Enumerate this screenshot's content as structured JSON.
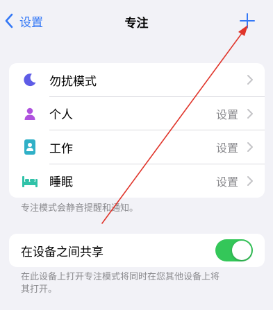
{
  "nav": {
    "back_label": "设置",
    "title": "专注"
  },
  "focus_modes": [
    {
      "label": "勿扰模式",
      "value": "",
      "icon": "moon-icon",
      "color": "#5e5ce6"
    },
    {
      "label": "个人",
      "value": "设置",
      "icon": "person-icon",
      "color": "#af52de"
    },
    {
      "label": "工作",
      "value": "设置",
      "icon": "badge-icon",
      "color": "#30b0c7"
    },
    {
      "label": "睡眠",
      "value": "设置",
      "icon": "bed-icon",
      "color": "#30c2a8"
    }
  ],
  "focus_footnote": "专注模式会静音提醒和通知。",
  "share": {
    "label": "在设备之间共享",
    "enabled": true,
    "footnote_line1": "在此设备上打开专注模式将同时在您其他设备上将",
    "footnote_line2": "其打开。"
  },
  "colors": {
    "accent": "#3478f6",
    "toggle_on": "#34c759",
    "annotation_arrow": "#e0352b"
  }
}
